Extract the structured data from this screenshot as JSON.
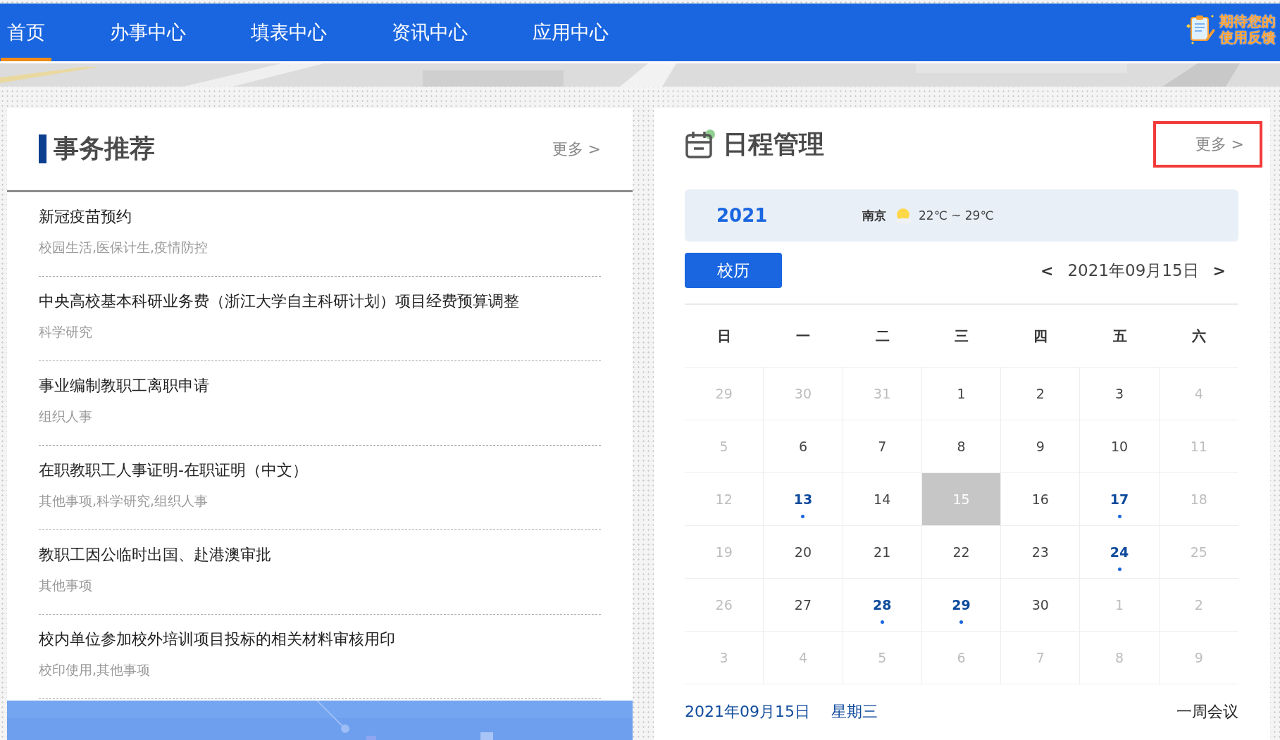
{
  "nav": {
    "items": [
      {
        "label": "首页",
        "selected": true
      },
      {
        "label": "办事中心",
        "selected": false
      },
      {
        "label": "填表中心",
        "selected": false
      },
      {
        "label": "资讯中心",
        "selected": false
      },
      {
        "label": "应用中心",
        "selected": false
      }
    ],
    "feedback": [
      "期待您的",
      "使用反馈"
    ]
  },
  "affairs": {
    "title": "事务推荐",
    "more": "更多 >",
    "items": [
      {
        "title": "新冠疫苗预约",
        "tags": "校园生活,医保计生,疫情防控"
      },
      {
        "title": "中央高校基本科研业务费（浙江大学自主科研计划）项目经费预算调整",
        "tags": "科学研究"
      },
      {
        "title": "事业编制教职工离职申请",
        "tags": "组织人事"
      },
      {
        "title": "在职教职工人事证明-在职证明（中文）",
        "tags": "其他事项,科学研究,组织人事"
      },
      {
        "title": "教职工因公临时出国、赴港澳审批",
        "tags": "其他事项"
      },
      {
        "title": "校内单位参加校外培训项目投标的相关材料审核用印",
        "tags": "校印使用,其他事项"
      }
    ]
  },
  "schedule": {
    "title": "日程管理",
    "more": {
      "label": "更多 >",
      "highlighted": true
    },
    "weather": {
      "year": "2021",
      "city": "南京",
      "temperature": "22℃ ~ 29℃"
    },
    "calendar_button": "校历",
    "prev": "<",
    "date": "2021年09月15日",
    "next": ">",
    "weekdays": [
      "日",
      "一",
      "二",
      "三",
      "四",
      "五",
      "六"
    ],
    "days": [
      {
        "day": "29",
        "muted": true,
        "event": false,
        "selected": false
      },
      {
        "day": "30",
        "muted": true,
        "event": false,
        "selected": false
      },
      {
        "day": "31",
        "muted": true,
        "event": false,
        "selected": false
      },
      {
        "day": "1",
        "muted": false,
        "event": false,
        "selected": false
      },
      {
        "day": "2",
        "muted": false,
        "event": false,
        "selected": false
      },
      {
        "day": "3",
        "muted": false,
        "event": false,
        "selected": false
      },
      {
        "day": "4",
        "muted": true,
        "event": false,
        "selected": false
      },
      {
        "day": "5",
        "muted": true,
        "event": false,
        "selected": false
      },
      {
        "day": "6",
        "muted": false,
        "event": false,
        "selected": false
      },
      {
        "day": "7",
        "muted": false,
        "event": false,
        "selected": false
      },
      {
        "day": "8",
        "muted": false,
        "event": false,
        "selected": false
      },
      {
        "day": "9",
        "muted": false,
        "event": false,
        "selected": false
      },
      {
        "day": "10",
        "muted": false,
        "event": false,
        "selected": false
      },
      {
        "day": "11",
        "muted": true,
        "event": false,
        "selected": false
      },
      {
        "day": "12",
        "muted": true,
        "event": false,
        "selected": false
      },
      {
        "day": "13",
        "muted": false,
        "event": true,
        "selected": false
      },
      {
        "day": "14",
        "muted": false,
        "event": false,
        "selected": false
      },
      {
        "day": "15",
        "muted": false,
        "event": false,
        "selected": true
      },
      {
        "day": "16",
        "muted": false,
        "event": false,
        "selected": false
      },
      {
        "day": "17",
        "muted": false,
        "event": true,
        "selected": false
      },
      {
        "day": "18",
        "muted": true,
        "event": false,
        "selected": false
      },
      {
        "day": "19",
        "muted": true,
        "event": false,
        "selected": false
      },
      {
        "day": "20",
        "muted": false,
        "event": false,
        "selected": false
      },
      {
        "day": "21",
        "muted": false,
        "event": false,
        "selected": false
      },
      {
        "day": "22",
        "muted": false,
        "event": false,
        "selected": false
      },
      {
        "day": "23",
        "muted": false,
        "event": false,
        "selected": false
      },
      {
        "day": "24",
        "muted": false,
        "event": true,
        "selected": false
      },
      {
        "day": "25",
        "muted": true,
        "event": false,
        "selected": false
      },
      {
        "day": "26",
        "muted": true,
        "event": false,
        "selected": false
      },
      {
        "day": "27",
        "muted": false,
        "event": false,
        "selected": false
      },
      {
        "day": "28",
        "muted": false,
        "event": true,
        "selected": false
      },
      {
        "day": "29",
        "muted": false,
        "event": true,
        "selected": false
      },
      {
        "day": "30",
        "muted": false,
        "event": false,
        "selected": false
      },
      {
        "day": "1",
        "muted": true,
        "event": false,
        "selected": false
      },
      {
        "day": "2",
        "muted": true,
        "event": false,
        "selected": false
      },
      {
        "day": "3",
        "muted": true,
        "event": false,
        "selected": false
      },
      {
        "day": "4",
        "muted": true,
        "event": false,
        "selected": false
      },
      {
        "day": "5",
        "muted": true,
        "event": false,
        "selected": false
      },
      {
        "day": "6",
        "muted": true,
        "event": false,
        "selected": false
      },
      {
        "day": "7",
        "muted": true,
        "event": false,
        "selected": false
      },
      {
        "day": "8",
        "muted": true,
        "event": false,
        "selected": false
      },
      {
        "day": "9",
        "muted": true,
        "event": false,
        "selected": false
      }
    ],
    "footer": {
      "date": "2021年09月15日",
      "weekday": "星期三",
      "meetings": "一周会议"
    }
  }
}
